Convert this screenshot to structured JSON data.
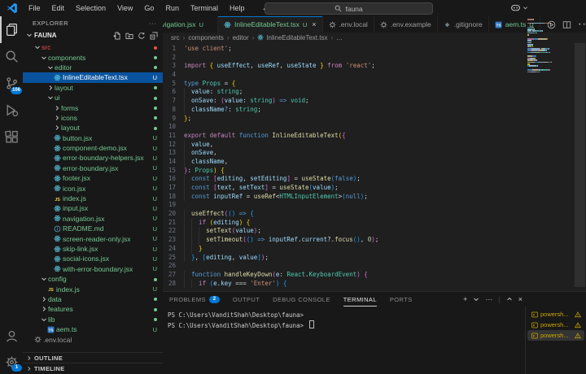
{
  "title_bar": {
    "menus": [
      "File",
      "Edit",
      "Selection",
      "View",
      "Go",
      "Run",
      "Terminal",
      "Help"
    ],
    "back_arrow": "←",
    "forward_arrow": "→",
    "search_value": "fauna"
  },
  "activity_bar": {
    "scm_badge": "106",
    "settings_badge": "1"
  },
  "explorer": {
    "title": "EXPLORER",
    "more_label": "···",
    "root": "FAUNA",
    "tree": [
      {
        "label": "src",
        "indent": 0,
        "type": "dir",
        "expanded": true,
        "color": "red",
        "badge": "dot"
      },
      {
        "label": "components",
        "indent": 1,
        "type": "dir",
        "expanded": true,
        "color": "green",
        "badge": "dot"
      },
      {
        "label": "editor",
        "indent": 2,
        "type": "dir",
        "expanded": true,
        "color": "green",
        "badge": "dot"
      },
      {
        "label": "InlineEditableText.tsx",
        "indent": 3,
        "type": "file",
        "icon": "react",
        "color": "white",
        "badge": "U",
        "selected": true
      },
      {
        "label": "layout",
        "indent": 2,
        "type": "dir",
        "expanded": false,
        "color": "green",
        "badge": "dot"
      },
      {
        "label": "ui",
        "indent": 2,
        "type": "dir",
        "expanded": true,
        "color": "green",
        "badge": "dot"
      },
      {
        "label": "forms",
        "indent": 3,
        "type": "dir",
        "expanded": false,
        "color": "green",
        "badge": "dot"
      },
      {
        "label": "icons",
        "indent": 3,
        "type": "dir",
        "expanded": false,
        "color": "green",
        "badge": "dot"
      },
      {
        "label": "layout",
        "indent": 3,
        "type": "dir",
        "expanded": false,
        "color": "green",
        "badge": "dot"
      },
      {
        "label": "button.jsx",
        "indent": 3,
        "type": "file",
        "icon": "react",
        "color": "green",
        "badge": "U"
      },
      {
        "label": "component-demo.jsx",
        "indent": 3,
        "type": "file",
        "icon": "react",
        "color": "green",
        "badge": "U"
      },
      {
        "label": "error-boundary-helpers.jsx",
        "indent": 3,
        "type": "file",
        "icon": "react",
        "color": "green",
        "badge": "U"
      },
      {
        "label": "error-boundary.jsx",
        "indent": 3,
        "type": "file",
        "icon": "react",
        "color": "green",
        "badge": "U"
      },
      {
        "label": "footer.jsx",
        "indent": 3,
        "type": "file",
        "icon": "react",
        "color": "green",
        "badge": "U"
      },
      {
        "label": "icon.jsx",
        "indent": 3,
        "type": "file",
        "icon": "react",
        "color": "green",
        "badge": "U"
      },
      {
        "label": "index.js",
        "indent": 3,
        "type": "file",
        "icon": "js",
        "color": "green",
        "badge": "U"
      },
      {
        "label": "input.jsx",
        "indent": 3,
        "type": "file",
        "icon": "react",
        "color": "green",
        "badge": "U"
      },
      {
        "label": "navigation.jsx",
        "indent": 3,
        "type": "file",
        "icon": "react",
        "color": "green",
        "badge": "U"
      },
      {
        "label": "README.md",
        "indent": 3,
        "type": "file",
        "icon": "info",
        "color": "green",
        "badge": "U"
      },
      {
        "label": "screen-reader-only.jsx",
        "indent": 3,
        "type": "file",
        "icon": "react",
        "color": "green",
        "badge": "U"
      },
      {
        "label": "skip-link.jsx",
        "indent": 3,
        "type": "file",
        "icon": "react",
        "color": "green",
        "badge": "U"
      },
      {
        "label": "social-icons.jsx",
        "indent": 3,
        "type": "file",
        "icon": "react",
        "color": "green",
        "badge": "U"
      },
      {
        "label": "with-error-boundary.jsx",
        "indent": 3,
        "type": "file",
        "icon": "react",
        "color": "green",
        "badge": "U"
      },
      {
        "label": "config",
        "indent": 1,
        "type": "dir",
        "expanded": true,
        "color": "green",
        "badge": "dot"
      },
      {
        "label": "index.js",
        "indent": 2,
        "type": "file",
        "icon": "js",
        "color": "green",
        "badge": "U"
      },
      {
        "label": "data",
        "indent": 1,
        "type": "dir",
        "expanded": false,
        "color": "green",
        "badge": "dot"
      },
      {
        "label": "features",
        "indent": 1,
        "type": "dir",
        "expanded": false,
        "color": "green",
        "badge": "dot"
      },
      {
        "label": "lib",
        "indent": 1,
        "type": "dir",
        "expanded": true,
        "color": "green",
        "badge": "dot"
      },
      {
        "label": "aem.ts",
        "indent": 2,
        "type": "file",
        "icon": "ts",
        "color": "green",
        "badge": "U"
      },
      {
        "label": ".env.local",
        "indent": 0,
        "type": "file",
        "icon": "gear",
        "color": "gray",
        "badge": ""
      }
    ],
    "sections": [
      "OUTLINE",
      "TIMELINE"
    ]
  },
  "tabs": [
    {
      "label": "navigation.jsx",
      "icon": "none",
      "badge": "U",
      "green": true,
      "clipped": true
    },
    {
      "label": "InlineEditableText.tsx",
      "icon": "react",
      "badge": "U",
      "green": true,
      "active": true,
      "close": "×"
    },
    {
      "label": ".env.local",
      "icon": "gear",
      "badge": ""
    },
    {
      "label": ".env.example",
      "icon": "gear",
      "badge": ""
    },
    {
      "label": ".gitignore",
      "icon": "git",
      "badge": ""
    },
    {
      "label": "aem.ts",
      "icon": "ts",
      "badge": "U",
      "green": true
    }
  ],
  "breadcrumb": [
    {
      "label": "src"
    },
    {
      "label": "components"
    },
    {
      "label": "editor"
    },
    {
      "label": "InlineEditableText.tsx",
      "icon": "react"
    },
    {
      "label": "…"
    }
  ],
  "editor": {
    "palette": {
      "str": "#ce9178",
      "kw": "#c586c0",
      "kw2": "#569cd6",
      "type": "#4ec9b0",
      "fn": "#dcdcaa",
      "var": "#9cdcfe",
      "num": "#b5cea8",
      "pun": "#d4d4d4",
      "b1": "#ffd700",
      "b2": "#da70d6",
      "b3": "#179fff"
    },
    "lines": [
      [
        [
          "'use client'",
          "str"
        ],
        [
          ";",
          "pun"
        ]
      ],
      [],
      [
        [
          "import ",
          "kw"
        ],
        [
          "{ ",
          "b1"
        ],
        [
          "useEffect",
          "var"
        ],
        [
          ", ",
          "pun"
        ],
        [
          "useRef",
          "var"
        ],
        [
          ", ",
          "pun"
        ],
        [
          "useState",
          "var"
        ],
        [
          " }",
          "b1"
        ],
        [
          " from ",
          "kw"
        ],
        [
          "'react'",
          "str"
        ],
        [
          ";",
          "pun"
        ]
      ],
      [],
      [
        [
          "type ",
          "kw2"
        ],
        [
          "Props",
          "type"
        ],
        [
          " = ",
          "pun"
        ],
        [
          "{",
          "b1"
        ]
      ],
      [
        [
          "  value",
          "var"
        ],
        [
          ": ",
          "pun"
        ],
        [
          "string",
          "type"
        ],
        [
          ";",
          "pun"
        ]
      ],
      [
        [
          "  onSave",
          "var"
        ],
        [
          ": ",
          "pun"
        ],
        [
          "(",
          "b2"
        ],
        [
          "value",
          "var"
        ],
        [
          ": ",
          "pun"
        ],
        [
          "string",
          "type"
        ],
        [
          ")",
          "b2"
        ],
        [
          " => ",
          "kw2"
        ],
        [
          "void",
          "type"
        ],
        [
          ";",
          "pun"
        ]
      ],
      [
        [
          "  className",
          "var"
        ],
        [
          "?",
          "kw2"
        ],
        [
          ": ",
          "pun"
        ],
        [
          "string",
          "type"
        ],
        [
          ";",
          "pun"
        ]
      ],
      [
        [
          "}",
          "b1"
        ],
        [
          ";",
          "pun"
        ]
      ],
      [],
      [
        [
          "export default ",
          "kw"
        ],
        [
          "function ",
          "kw2"
        ],
        [
          "InlineEditableText",
          "fn"
        ],
        [
          "(",
          "b1"
        ],
        [
          "{",
          "b2"
        ]
      ],
      [
        [
          "  value",
          "var"
        ],
        [
          ",",
          "pun"
        ]
      ],
      [
        [
          "  onSave",
          "var"
        ],
        [
          ",",
          "pun"
        ]
      ],
      [
        [
          "  className",
          "var"
        ],
        [
          ",",
          "pun"
        ]
      ],
      [
        [
          "}",
          "b2"
        ],
        [
          ": ",
          "pun"
        ],
        [
          "Props",
          "type"
        ],
        [
          ") ",
          "b1"
        ],
        [
          "{",
          "b1"
        ]
      ],
      [
        [
          "  const ",
          "kw2"
        ],
        [
          "[",
          "b2"
        ],
        [
          "editing",
          "var"
        ],
        [
          ", ",
          "pun"
        ],
        [
          "setEditing",
          "var"
        ],
        [
          "] ",
          "b2"
        ],
        [
          "= ",
          "pun"
        ],
        [
          "useState",
          "fn"
        ],
        [
          "(",
          "b3"
        ],
        [
          "false",
          "kw2"
        ],
        [
          ")",
          "b3"
        ],
        [
          ";",
          "pun"
        ]
      ],
      [
        [
          "  const ",
          "kw2"
        ],
        [
          "[",
          "b2"
        ],
        [
          "text",
          "var"
        ],
        [
          ", ",
          "pun"
        ],
        [
          "setText",
          "var"
        ],
        [
          "] ",
          "b2"
        ],
        [
          "= ",
          "pun"
        ],
        [
          "useState",
          "fn"
        ],
        [
          "(",
          "b3"
        ],
        [
          "value",
          "var"
        ],
        [
          ")",
          "b3"
        ],
        [
          ";",
          "pun"
        ]
      ],
      [
        [
          "  const ",
          "kw2"
        ],
        [
          "inputRef ",
          "var"
        ],
        [
          "= ",
          "pun"
        ],
        [
          "useRef",
          "fn"
        ],
        [
          "<",
          "pun"
        ],
        [
          "HTMLInputElement",
          "type"
        ],
        [
          ">",
          "pun"
        ],
        [
          "(",
          "b3"
        ],
        [
          "null",
          "kw2"
        ],
        [
          ")",
          "b3"
        ],
        [
          ";",
          "pun"
        ]
      ],
      [],
      [
        [
          "  useEffect",
          "fn"
        ],
        [
          "(",
          "b2"
        ],
        [
          "() ",
          "b3"
        ],
        [
          "=> ",
          "kw2"
        ],
        [
          "{",
          "b3"
        ]
      ],
      [
        [
          "    if ",
          "kw"
        ],
        [
          "(",
          "b1"
        ],
        [
          "editing",
          "var"
        ],
        [
          ") ",
          "b1"
        ],
        [
          "{",
          "b1"
        ]
      ],
      [
        [
          "      setText",
          "fn"
        ],
        [
          "(",
          "b2"
        ],
        [
          "value",
          "var"
        ],
        [
          ")",
          "b2"
        ],
        [
          ";",
          "pun"
        ]
      ],
      [
        [
          "      setTimeout",
          "fn"
        ],
        [
          "(",
          "b2"
        ],
        [
          "() ",
          "b3"
        ],
        [
          "=> ",
          "kw2"
        ],
        [
          "inputRef",
          "var"
        ],
        [
          ".",
          "pun"
        ],
        [
          "current",
          "var"
        ],
        [
          "?.",
          "pun"
        ],
        [
          "focus",
          "fn"
        ],
        [
          "()",
          "b3"
        ],
        [
          ", ",
          "pun"
        ],
        [
          "0",
          "num"
        ],
        [
          ")",
          "b2"
        ],
        [
          ";",
          "pun"
        ]
      ],
      [
        [
          "    }",
          "b1"
        ]
      ],
      [
        [
          "  }",
          "b3"
        ],
        [
          ", ",
          "pun"
        ],
        [
          "[",
          "b3"
        ],
        [
          "editing",
          "var"
        ],
        [
          ", ",
          "pun"
        ],
        [
          "value",
          "var"
        ],
        [
          "]",
          "b3"
        ],
        [
          ")",
          "b2"
        ],
        [
          ";",
          "pun"
        ]
      ],
      [],
      [
        [
          "  function ",
          "kw2"
        ],
        [
          "handleKeyDown",
          "fn"
        ],
        [
          "(",
          "b2"
        ],
        [
          "e",
          "var"
        ],
        [
          ": ",
          "pun"
        ],
        [
          "React",
          "type"
        ],
        [
          ".",
          "pun"
        ],
        [
          "KeyboardEvent",
          "type"
        ],
        [
          ") ",
          "b2"
        ],
        [
          "{",
          "b2"
        ]
      ],
      [
        [
          "    if ",
          "kw"
        ],
        [
          "(",
          "b3"
        ],
        [
          "e",
          "var"
        ],
        [
          ".",
          "pun"
        ],
        [
          "key ",
          "var"
        ],
        [
          "=== ",
          "pun"
        ],
        [
          "'Enter'",
          "str"
        ],
        [
          ") ",
          "b3"
        ],
        [
          "{",
          "b3"
        ]
      ]
    ]
  },
  "panel": {
    "tabs": [
      {
        "label": "PROBLEMS",
        "badge": "2"
      },
      {
        "label": "OUTPUT"
      },
      {
        "label": "DEBUG CONSOLE"
      },
      {
        "label": "TERMINAL",
        "active": true
      },
      {
        "label": "PORTS"
      }
    ],
    "terminal_lines": [
      "PS C:\\Users\\VanditShah\\Desktop\\fauna>",
      "PS C:\\Users\\VanditShah\\Desktop\\fauna>"
    ],
    "terminal_list": [
      {
        "label": "powersh...",
        "warning": true
      },
      {
        "label": "powersh...",
        "warning": true
      },
      {
        "label": "powersh...",
        "warning": true,
        "selected": true
      }
    ]
  }
}
